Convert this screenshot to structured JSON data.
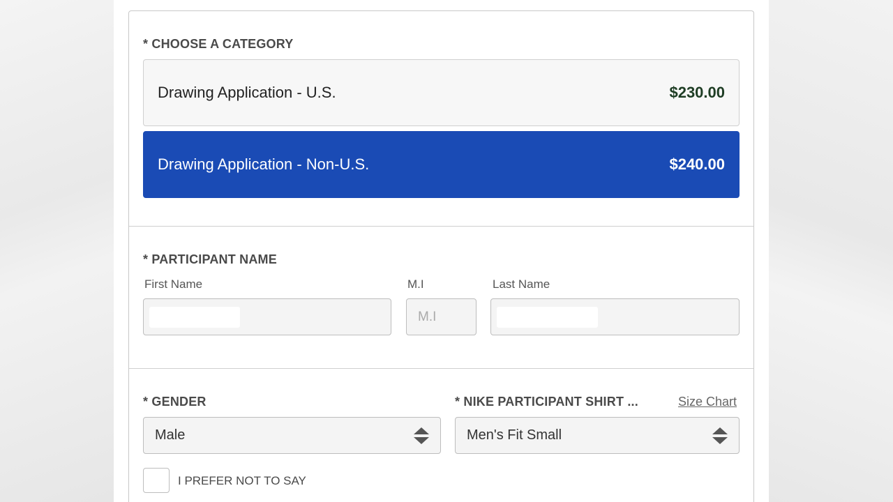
{
  "category": {
    "title": "* CHOOSE A CATEGORY",
    "options": [
      {
        "label": "Drawing Application - U.S.",
        "price": "$230.00",
        "selected": false
      },
      {
        "label": "Drawing Application - Non-U.S.",
        "price": "$240.00",
        "selected": true
      }
    ]
  },
  "participant": {
    "title": "* PARTICIPANT NAME",
    "first_name_label": "First Name",
    "mi_label": "M.I",
    "mi_placeholder": "M.I",
    "last_name_label": "Last Name"
  },
  "gender": {
    "title": "* GENDER",
    "selected": "Male",
    "prefer_not_label": "I PREFER NOT TO SAY"
  },
  "shirt": {
    "title": "* NIKE PARTICIPANT SHIRT ...",
    "size_chart_link": "Size Chart",
    "selected": "Men's Fit Small"
  },
  "colors": {
    "selected_option_bg": "#1a4bb5",
    "price_text": "#1e3d24"
  }
}
